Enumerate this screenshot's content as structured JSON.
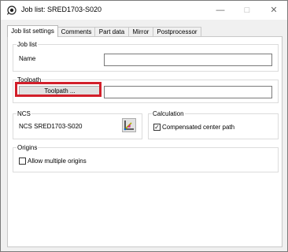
{
  "window": {
    "title": "Job list:  SRED1703-S020"
  },
  "tabs": [
    {
      "label": "Job list settings",
      "active": true
    },
    {
      "label": "Comments",
      "active": false
    },
    {
      "label": "Part data",
      "active": false
    },
    {
      "label": "Mirror",
      "active": false
    },
    {
      "label": "Postprocessor",
      "active": false
    }
  ],
  "groups": {
    "job_list": {
      "label": "Job list",
      "name_label": "Name",
      "name_value": ""
    },
    "toolpath": {
      "label": "Toolpath",
      "button_label": "Toolpath ...",
      "field_value": ""
    },
    "ncs": {
      "label": "NCS",
      "value": "NCS SRED1703-S020",
      "button_icon": "coordinate-system-icon"
    },
    "calculation": {
      "label": "Calculation",
      "compensated_label": "Compensated center path",
      "compensated_checked": true
    },
    "origins": {
      "label": "Origins",
      "allow_multiple_label": "Allow multiple origins",
      "allow_multiple_checked": false
    }
  },
  "colors": {
    "highlight": "#d21f2a",
    "active_tab": "#ffffff",
    "window_bg": "#f0f0f0"
  }
}
